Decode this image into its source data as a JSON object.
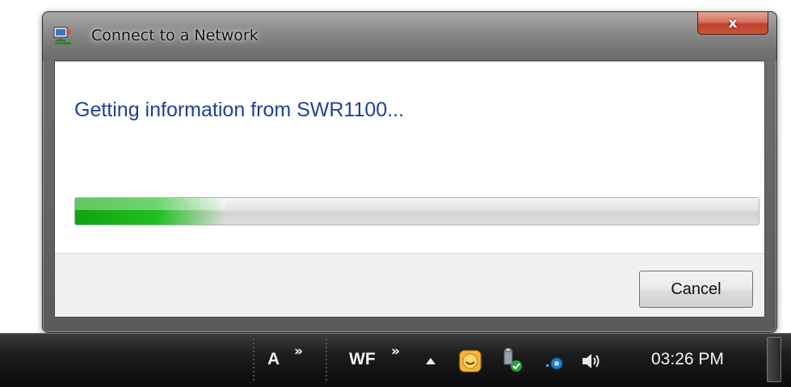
{
  "window": {
    "title": "Connect to a Network",
    "close_label": "x"
  },
  "dialog": {
    "heading": "Getting information from SWR1100...",
    "progress_fraction": 0.22,
    "cancel_label": "Cancel"
  },
  "taskbar": {
    "toolbars": [
      {
        "label": "A",
        "chevron": "»"
      },
      {
        "label": "WF",
        "chevron": "»"
      }
    ],
    "tray_icons": [
      "show-hidden-icons-arrow",
      "messenger-icon",
      "usb-safely-remove-icon",
      "network-icon",
      "volume-icon"
    ],
    "clock": "03:26 PM"
  },
  "colors": {
    "heading": "#1e3f9c",
    "progress": "#22c022",
    "close_button": "#c9553d",
    "taskbar": "#111111"
  }
}
